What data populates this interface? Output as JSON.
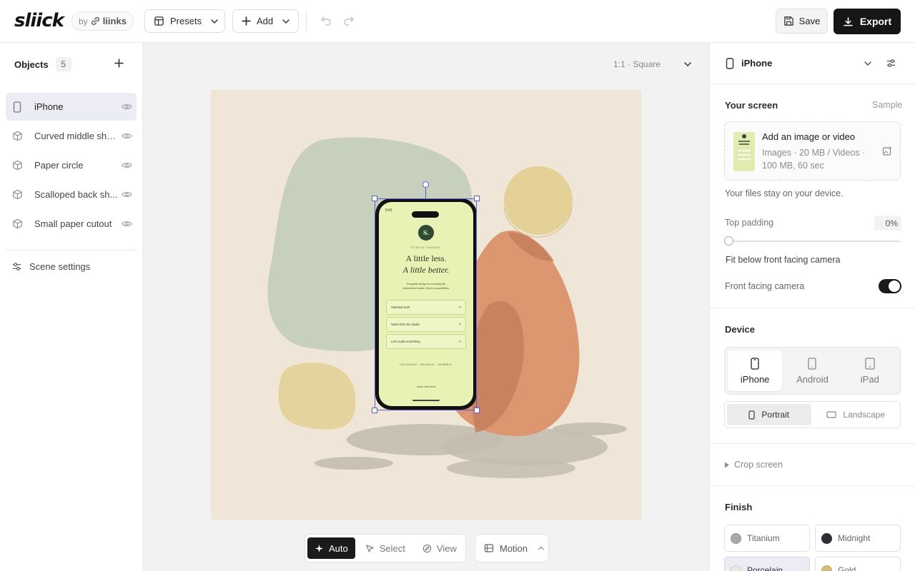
{
  "header": {
    "logo": "sliick",
    "by_label": "by",
    "by_brand": "liinks",
    "presets_label": "Presets",
    "add_label": "Add",
    "save_label": "Save",
    "export_label": "Export"
  },
  "objects": {
    "title": "Objects",
    "count": "5",
    "items": [
      {
        "label": "iPhone",
        "icon": "phone-icon",
        "active": true
      },
      {
        "label": "Curved middle sheet",
        "icon": "cube-icon",
        "active": false
      },
      {
        "label": "Paper circle",
        "icon": "cube-icon",
        "active": false
      },
      {
        "label": "Scalloped back sh...",
        "icon": "cube-icon",
        "active": false
      },
      {
        "label": "Small paper cutout",
        "icon": "cube-icon",
        "active": false
      }
    ],
    "scene_settings": "Scene settings"
  },
  "canvas": {
    "aspect_label": "1:1 · Square",
    "background_color": "#efe6d7"
  },
  "phone_screen": {
    "time": "9:41",
    "logo_mark": "S.",
    "studio": "STUDIO SUNDAY",
    "headline_1": "A little less.",
    "headline_2": "A little better.",
    "tagline_1": "Thoughtful design for everyday life.",
    "tagline_2": "Independent studio. Open to possibilities.",
    "links": [
      "Selected work",
      "Notes from the studio",
      "Let's make something"
    ],
    "social": "INSTAGRAM · BEHANCE · DRIBBBLE",
    "footer": "made with liinks",
    "screen_color": "#e8f2b4"
  },
  "bottom_toolbar": {
    "auto_label": "Auto",
    "select_label": "Select",
    "view_label": "View",
    "motion_label": "Motion"
  },
  "right_panel": {
    "header_title": "iPhone",
    "screen": {
      "title": "Your screen",
      "sample_link": "Sample",
      "upload_title": "Add an image or video",
      "upload_hint": "Images · 20 MB / Videos · 100 MB, 60 sec",
      "privacy_note": "Your files stay on your device.",
      "top_padding_label": "Top padding",
      "top_padding_value": "0%",
      "top_padding_fraction": 0,
      "fit_label": "Fit below front facing camera",
      "camera_label": "Front facing camera",
      "camera_on": true
    },
    "device": {
      "title": "Device",
      "options": [
        "iPhone",
        "Android",
        "iPad"
      ],
      "selected": "iPhone",
      "orientations": [
        "Portrait",
        "Landscape"
      ],
      "orientation_selected": "Portrait"
    },
    "crop_label": "Crop screen",
    "finish": {
      "title": "Finish",
      "options": [
        {
          "label": "Titanium",
          "color": "#a9a9a9"
        },
        {
          "label": "Midnight",
          "color": "#2b2f33"
        },
        {
          "label": "Porcelain",
          "color": "#efe7e2"
        },
        {
          "label": "Gold",
          "color": "#d9bb78"
        }
      ],
      "selected": "Porcelain"
    }
  }
}
